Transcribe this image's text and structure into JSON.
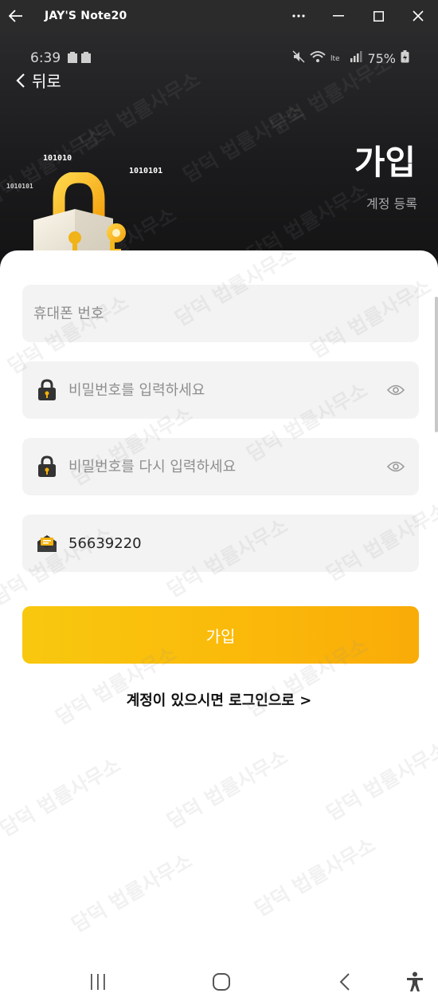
{
  "window": {
    "title": "JAY'S Note20"
  },
  "status_bar": {
    "time": "6:39",
    "battery": "75%"
  },
  "header": {
    "back_label": "뒤로",
    "title": "가입",
    "subtitle": "계정 등록",
    "binary_left": "1010101",
    "binary_mid": "101010",
    "binary_right": "1010101"
  },
  "form": {
    "phone_placeholder": "휴대폰 번호",
    "password_placeholder": "비밀번호를 입력하세요",
    "password_confirm_placeholder": "비밀번호를 다시 입력하세요",
    "invite_code_value": "56639220",
    "submit_label": "가입",
    "login_link": "계정이 있으시면 로그인으로 >"
  },
  "watermark_text": "담덕 법률사무소",
  "colors": {
    "accent": "#fbb80a",
    "dark_bg": "#1b1b1d",
    "field_bg": "#f3f3f3"
  },
  "icons": {
    "back": "arrow-left-icon",
    "lock": "padlock-icon",
    "eye": "eye-icon",
    "envelope": "envelope-icon"
  }
}
